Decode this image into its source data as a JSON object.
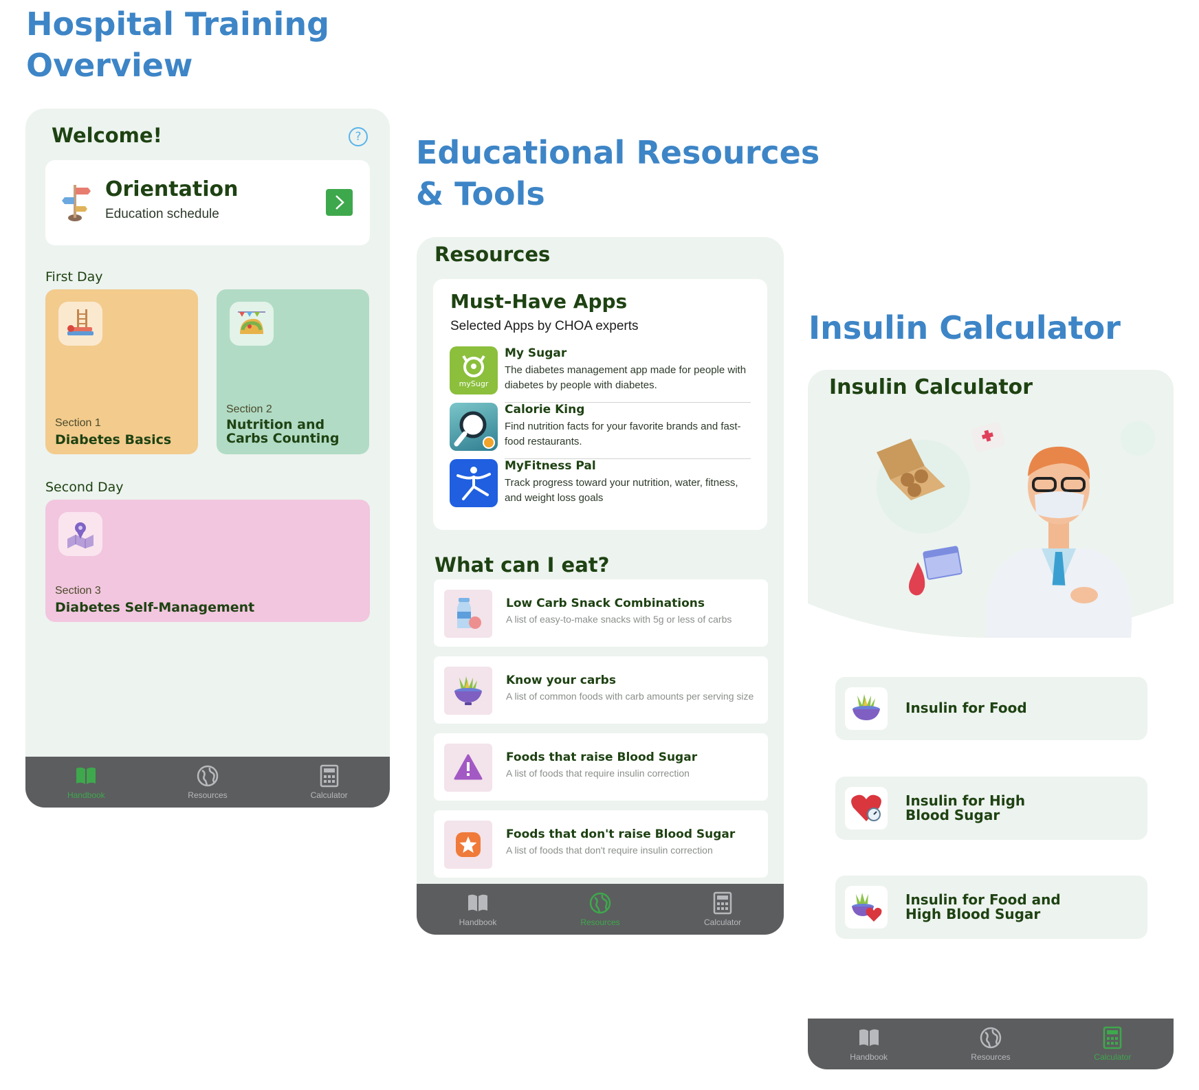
{
  "titles": {
    "col1": [
      "Hospital Training",
      "Overview"
    ],
    "col2": [
      "Educational Resources",
      "& Tools"
    ],
    "col3": [
      "Insulin Calculator"
    ]
  },
  "tabbar": {
    "handbook": "Handbook",
    "resources": "Resources",
    "calculator": "Calculator"
  },
  "handbook": {
    "welcome": "Welcome!",
    "help_icon": "question-circle-icon",
    "orientation": {
      "title": "Orientation",
      "subtitle": "Education schedule",
      "icon": "signpost-icon"
    },
    "first_day": "First Day",
    "second_day": "Second Day",
    "sections": [
      {
        "label": "Section 1",
        "title": "Diabetes Basics",
        "color": "#f2cb8d"
      },
      {
        "label": "Section 2",
        "title": "Nutrition and Carbs Counting",
        "color": "#b1dbc5"
      },
      {
        "label": "Section 3",
        "title": "Diabetes Self-Management",
        "color": "#f2c6df"
      }
    ]
  },
  "resources": {
    "heading": "Resources",
    "apps_title": "Must-Have Apps",
    "apps_subtitle": "Selected Apps by CHOA experts",
    "apps": [
      {
        "name": "My Sugar",
        "desc": "The diabetes management app made for people with diabetes by people with diabetes.",
        "logo_text": "mySugr",
        "color": "#8bbf3c"
      },
      {
        "name": "Calorie King",
        "desc": "Find nutrition facts for your favorite brands and fast-food restaurants.",
        "color": "#4aa0a8"
      },
      {
        "name": "MyFitness Pal",
        "desc": "Track progress toward your nutrition, water, fitness, and weight loss goals",
        "color": "#1f5fe0"
      }
    ],
    "eat_heading": "What can I eat?",
    "eat_items": [
      {
        "title": "Low Carb Snack Combinations",
        "sub": "A list of easy-to-make snacks with 5g or less of carbs"
      },
      {
        "title": "Know your carbs",
        "sub": "A list of common foods with carb amounts per serving size"
      },
      {
        "title": "Foods that raise Blood Sugar",
        "sub": "A list of foods that require insulin correction"
      },
      {
        "title": "Foods that don't raise Blood Sugar",
        "sub": "A list of foods that don't require insulin correction"
      }
    ]
  },
  "calculator": {
    "heading": "Insulin Calculator",
    "buttons": [
      {
        "line1": "Insulin for Food",
        "line2": ""
      },
      {
        "line1": "Insulin for High",
        "line2": "Blood Sugar"
      },
      {
        "line1": "Insulin for Food and",
        "line2": "High Blood Sugar"
      }
    ]
  }
}
